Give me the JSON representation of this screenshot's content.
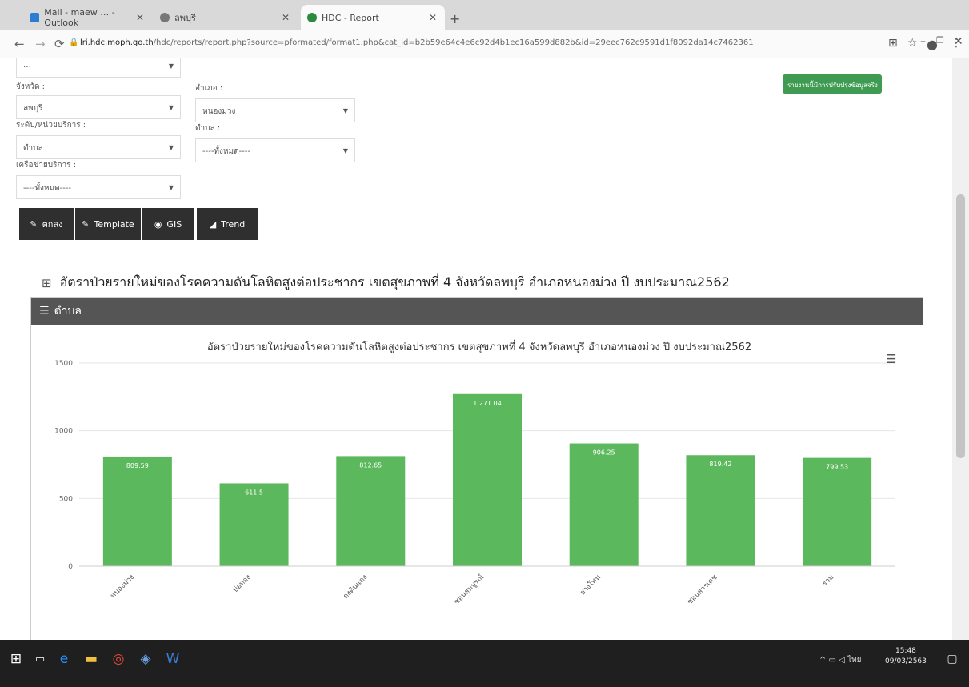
{
  "browser": {
    "tabs": [
      {
        "title": "Mail - maew … - Outlook",
        "color": "#2b7cd3"
      },
      {
        "title": "ลพบุรี",
        "color": "#777777"
      },
      {
        "title": "HDC - Report",
        "color": "#2b8a3e"
      }
    ],
    "new_tab": "+",
    "url_host": "lri.hdc.moph.go.th",
    "url_path": "/hdc/reports/report.php?source=pformated/format1.php&cat_id=b2b59e64c4e6c92d4b1ec16a599d882b&id=29eec762c9591d1f8092da14c7462361"
  },
  "filters": {
    "top_select": "…",
    "province_label": "จังหวัด :",
    "province_value": "ลพบุรี",
    "district_label": "อำเภอ :",
    "district_value": "หนองม่วง",
    "level_label": "ระดับ/หน่วยบริการ :",
    "level_value": "ตำบล",
    "subdistrict_label": "ตำบล :",
    "subdistrict_value": "----ทั้งหมด----",
    "network_label": "เครือข่ายบริการ :",
    "network_value": "----ทั้งหมด----",
    "green_button": "รายงานนี้มีการปรับปรุงข้อมูลจริง"
  },
  "buttons": {
    "kpi": "ตกลง",
    "template": "Template",
    "gis": "GIS",
    "trend": "Trend"
  },
  "report_title": "อัตราป่วยรายใหม่ของโรคความดันโลหิตสูงต่อประชากร เขตสุขภาพที่ 4 จังหวัดลพบุรี อำเภอหนองม่วง ปี งบประมาณ2562",
  "panel_title": "ตำบล",
  "chart_data": {
    "type": "bar",
    "title": "อัตราป่วยรายใหม่ของโรคความดันโลหิตสูงต่อประชากร เขตสุขภาพที่ 4 จังหวัดลพบุรี อำเภอหนองม่วง ปี งบประมาณ2562",
    "categories": [
      "หนองม่วง",
      "บ่อทอง",
      "ดงดินแดง",
      "ชอนสมบูรณ์",
      "ยางโทน",
      "ชอนสารเดช",
      "รวม"
    ],
    "values": [
      809.59,
      611.5,
      812.65,
      1271.04,
      906.25,
      819.42,
      799.53
    ],
    "data_labels": [
      "809.59",
      "611.5",
      "812.65",
      "1,271.04",
      "906.25",
      "819.42",
      "799.53"
    ],
    "ylim": [
      0,
      1500
    ],
    "yticks": [
      "0",
      "500",
      "1000",
      "1500"
    ],
    "grid": true,
    "bar_color": "#5cb85c"
  },
  "taskbar": {
    "time": "15:48",
    "date": "09/03/2563",
    "lang": "ไทย"
  }
}
